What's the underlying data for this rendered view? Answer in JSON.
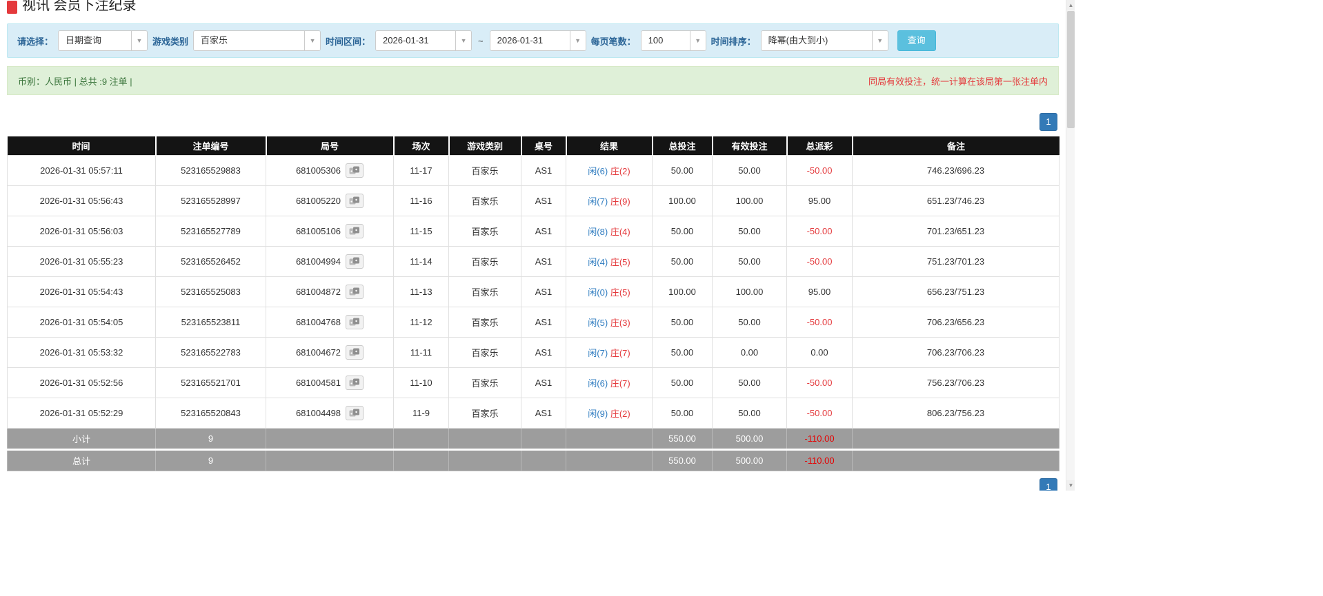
{
  "page": {
    "title": "视讯 会员下注纪录"
  },
  "icons": {
    "dropdown_caret": "▼",
    "scroll_up": "▲",
    "scroll_down": "▼"
  },
  "colors": {
    "accent_blue": "#337ab7",
    "result_player_blue": "#2f7cc0",
    "result_banker_red": "#e4393c",
    "negative_red": "#e60000",
    "table_header_bg": "#141414",
    "summary_row_bg": "#9d9d9d",
    "filter_bar_bg": "#d9edf7",
    "info_bar_bg": "#dff0d8",
    "query_button_bg": "#5bc0de"
  },
  "filters": {
    "select_label": "请选择：",
    "select_value": "日期查询",
    "game_label": "游戏类别",
    "game_value": "百家乐",
    "range_label": "时间区间：",
    "date_from": "2026-01-31",
    "range_separator": "~",
    "date_to": "2026-01-31",
    "per_page_label": "每页笔数：",
    "per_page_value": "100",
    "sort_label": "时间排序：",
    "sort_value": "降幂(由大到小)",
    "query_button": "查询"
  },
  "info_bar": {
    "left": "币别：人民币 | 总共 :9 注单 |",
    "right": "同局有效投注，统一计算在该局第一张注单内"
  },
  "pagination": {
    "page": "1"
  },
  "table": {
    "headers": [
      "时间",
      "注单编号",
      "局号",
      "场次",
      "游戏类别",
      "桌号",
      "结果",
      "总投注",
      "有效投注",
      "总派彩",
      "备注"
    ],
    "rows": [
      {
        "time": "2026-01-31 05:57:11",
        "bet_id": "523165529883",
        "round_id": "681005306",
        "session": "11-17",
        "game": "百家乐",
        "table_no": "AS1",
        "result_player": "闲(6)",
        "result_banker": "庄(2)",
        "total_bet": "50.00",
        "valid_bet": "50.00",
        "payout": "-50.00",
        "remark": "746.23/696.23"
      },
      {
        "time": "2026-01-31 05:56:43",
        "bet_id": "523165528997",
        "round_id": "681005220",
        "session": "11-16",
        "game": "百家乐",
        "table_no": "AS1",
        "result_player": "闲(7)",
        "result_banker": "庄(9)",
        "total_bet": "100.00",
        "valid_bet": "100.00",
        "payout": "95.00",
        "remark": "651.23/746.23"
      },
      {
        "time": "2026-01-31 05:56:03",
        "bet_id": "523165527789",
        "round_id": "681005106",
        "session": "11-15",
        "game": "百家乐",
        "table_no": "AS1",
        "result_player": "闲(8)",
        "result_banker": "庄(4)",
        "total_bet": "50.00",
        "valid_bet": "50.00",
        "payout": "-50.00",
        "remark": "701.23/651.23"
      },
      {
        "time": "2026-01-31 05:55:23",
        "bet_id": "523165526452",
        "round_id": "681004994",
        "session": "11-14",
        "game": "百家乐",
        "table_no": "AS1",
        "result_player": "闲(4)",
        "result_banker": "庄(5)",
        "total_bet": "50.00",
        "valid_bet": "50.00",
        "payout": "-50.00",
        "remark": "751.23/701.23"
      },
      {
        "time": "2026-01-31 05:54:43",
        "bet_id": "523165525083",
        "round_id": "681004872",
        "session": "11-13",
        "game": "百家乐",
        "table_no": "AS1",
        "result_player": "闲(0)",
        "result_banker": "庄(5)",
        "total_bet": "100.00",
        "valid_bet": "100.00",
        "payout": "95.00",
        "remark": "656.23/751.23"
      },
      {
        "time": "2026-01-31 05:54:05",
        "bet_id": "523165523811",
        "round_id": "681004768",
        "session": "11-12",
        "game": "百家乐",
        "table_no": "AS1",
        "result_player": "闲(5)",
        "result_banker": "庄(3)",
        "total_bet": "50.00",
        "valid_bet": "50.00",
        "payout": "-50.00",
        "remark": "706.23/656.23"
      },
      {
        "time": "2026-01-31 05:53:32",
        "bet_id": "523165522783",
        "round_id": "681004672",
        "session": "11-11",
        "game": "百家乐",
        "table_no": "AS1",
        "result_player": "闲(7)",
        "result_banker": "庄(7)",
        "total_bet": "50.00",
        "valid_bet": "0.00",
        "payout": "0.00",
        "remark": "706.23/706.23"
      },
      {
        "time": "2026-01-31 05:52:56",
        "bet_id": "523165521701",
        "round_id": "681004581",
        "session": "11-10",
        "game": "百家乐",
        "table_no": "AS1",
        "result_player": "闲(6)",
        "result_banker": "庄(7)",
        "total_bet": "50.00",
        "valid_bet": "50.00",
        "payout": "-50.00",
        "remark": "756.23/706.23"
      },
      {
        "time": "2026-01-31 05:52:29",
        "bet_id": "523165520843",
        "round_id": "681004498",
        "session": "11-9",
        "game": "百家乐",
        "table_no": "AS1",
        "result_player": "闲(9)",
        "result_banker": "庄(2)",
        "total_bet": "50.00",
        "valid_bet": "50.00",
        "payout": "-50.00",
        "remark": "806.23/756.23"
      }
    ],
    "subtotal": {
      "label": "小计",
      "count": "9",
      "total_bet": "550.00",
      "valid_bet": "500.00",
      "payout": "-110.00"
    },
    "total": {
      "label": "总计",
      "count": "9",
      "total_bet": "550.00",
      "valid_bet": "500.00",
      "payout": "-110.00"
    }
  }
}
